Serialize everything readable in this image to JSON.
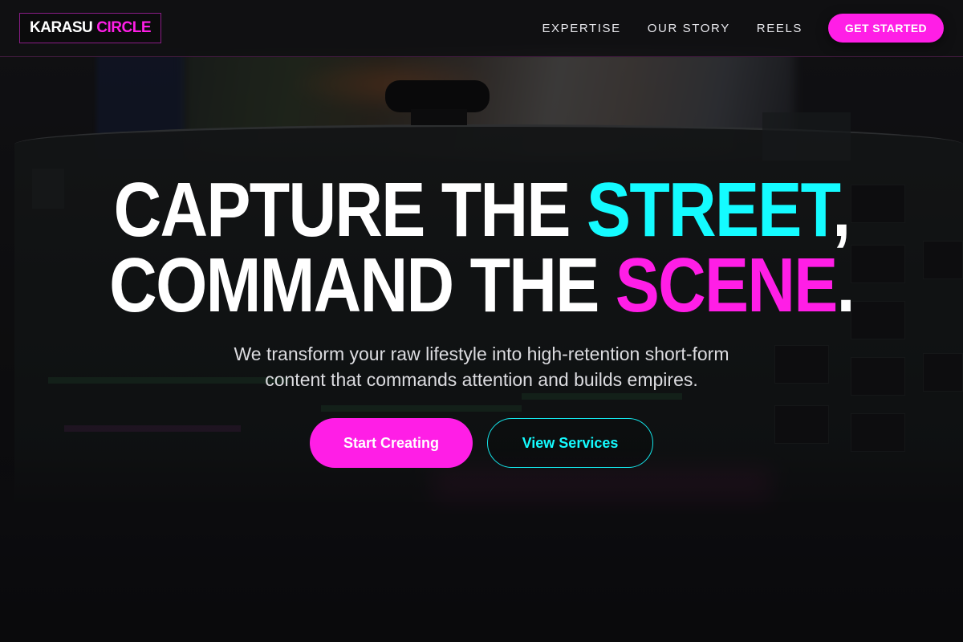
{
  "nav": {
    "logo_part1": "KARASU",
    "logo_part2": "CIRCLE",
    "links": [
      "EXPERTISE",
      "OUR STORY",
      "REELS"
    ],
    "cta": "GET STARTED"
  },
  "hero": {
    "headline_line1_prefix": "CAPTURE THE",
    "headline_line1_accent": "STREET",
    "headline_line1_suffix": ",",
    "headline_line2_prefix": "COMMAND THE",
    "headline_line2_accent": "SCENE",
    "headline_line2_suffix": ".",
    "subtitle": "We transform your raw lifestyle into high-retention short-form content that commands attention and builds empires.",
    "primary_button": "Start Creating",
    "secondary_button": "View Services"
  },
  "colors": {
    "accent_pink": "#ff1ee6",
    "accent_cyan": "#14fbff",
    "background": "#0e0e10"
  }
}
